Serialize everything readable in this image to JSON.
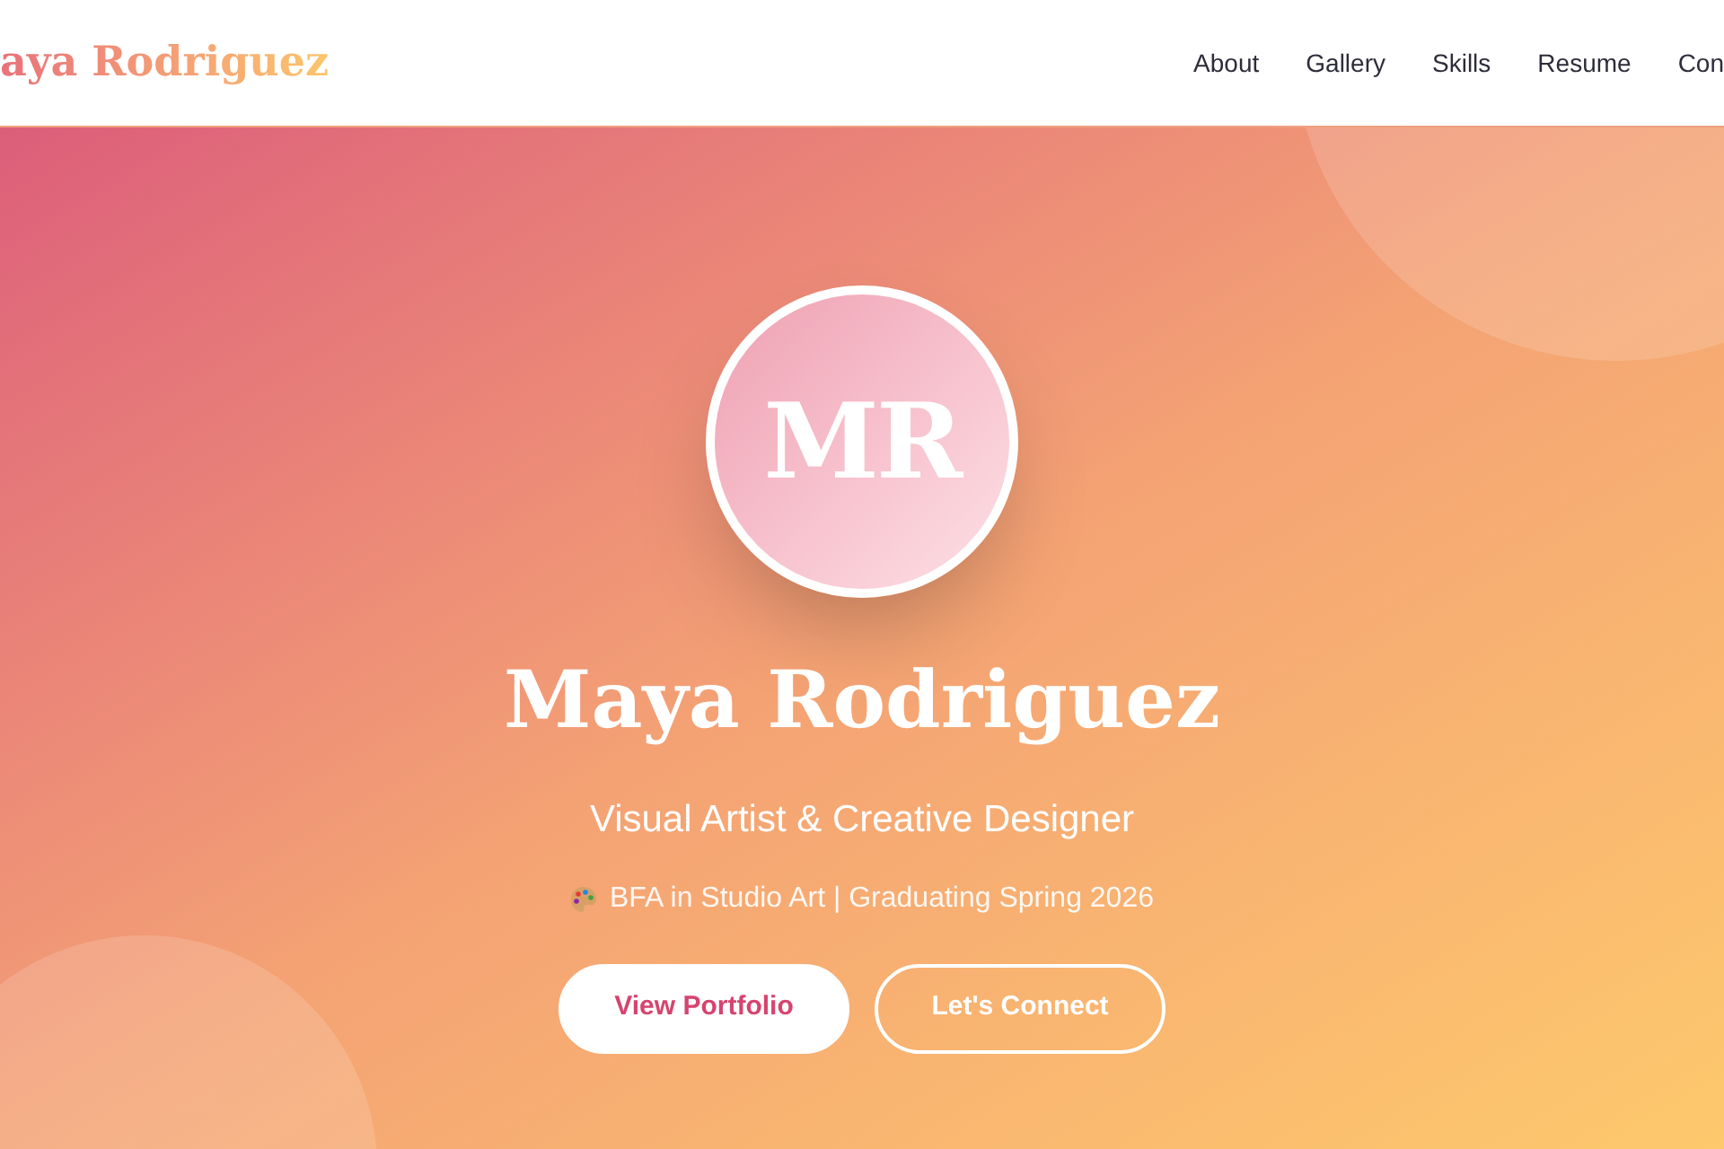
{
  "header": {
    "logo": "aya Rodriguez",
    "nav": [
      {
        "label": "About"
      },
      {
        "label": "Gallery"
      },
      {
        "label": "Skills"
      },
      {
        "label": "Resume"
      },
      {
        "label": "Con"
      }
    ]
  },
  "hero": {
    "initials": "MR",
    "name": "Maya Rodriguez",
    "tagline": "Visual Artist & Creative Designer",
    "subtitle": "BFA in Studio Art | Graduating Spring 2026",
    "buttons": [
      {
        "label": "View Portfolio",
        "kind": "solid"
      },
      {
        "label": "Let's Connect",
        "kind": "outline"
      }
    ]
  }
}
